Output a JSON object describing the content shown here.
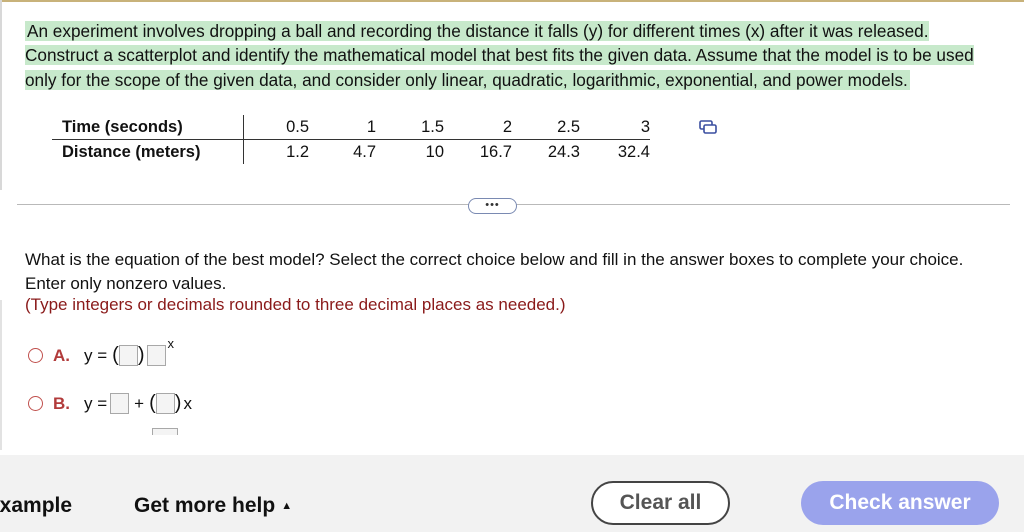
{
  "question": {
    "text": "An experiment involves dropping a ball and recording the distance it falls (y) for different times (x) after it was released. Construct a scatterplot and identify the mathematical model that best fits the given data. Assume that the model is to be used only for the scope of the given data, and consider only linear, quadratic, logarithmic, exponential, and power models."
  },
  "table": {
    "row1_label": "Time (seconds)",
    "row2_label": "Distance (meters)",
    "times": [
      "0.5",
      "1",
      "1.5",
      "2",
      "2.5",
      "3"
    ],
    "distances": [
      "1.2",
      "4.7",
      "10",
      "16.7",
      "24.3",
      "32.4"
    ]
  },
  "more_pill": "•••",
  "prompt": "What is the equation of the best model? Select the correct choice below and fill in the answer boxes to complete your choice. Enter only nonzero values.",
  "instruction": "(Type integers or decimals rounded to three decimal places as needed.)",
  "choices": {
    "a": {
      "letter": "A.",
      "lhs": "y =",
      "exponent": "x"
    },
    "b": {
      "letter": "B.",
      "lhs": "y =",
      "plus": "+",
      "var": "x"
    }
  },
  "footer": {
    "example": "example",
    "help": "Get more help",
    "help_caret": "▲",
    "clear": "Clear all",
    "check": "Check answer"
  },
  "colors": {
    "highlight": "#c7e9cb",
    "radio": "#c0504d",
    "instruction": "#8a1a1a",
    "check_button": "#9aa3ec"
  }
}
